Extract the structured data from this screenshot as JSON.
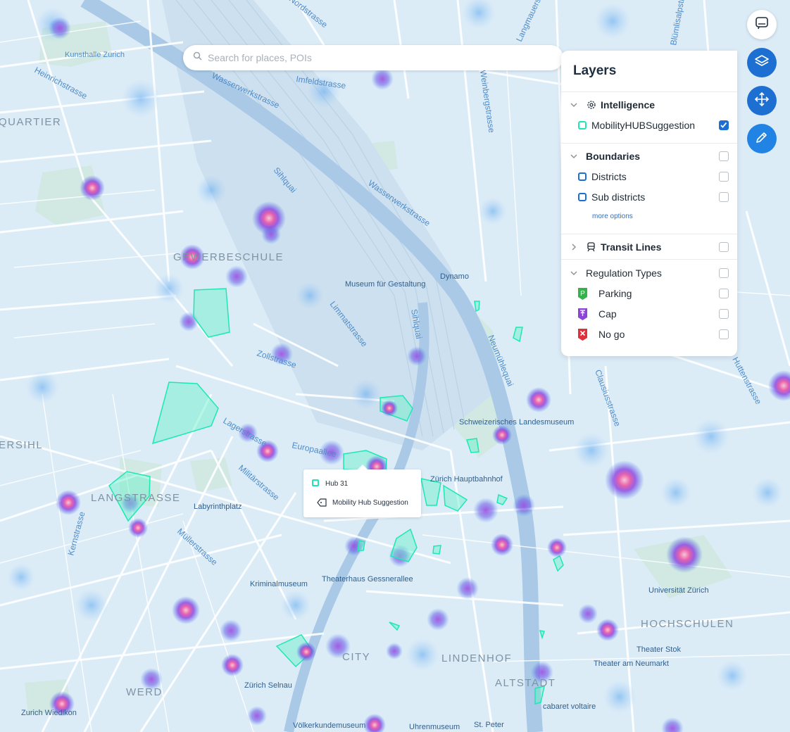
{
  "search": {
    "placeholder": "Search for places, POIs"
  },
  "buttons": {
    "chat": "chat-icon",
    "layers": "layers-icon",
    "move": "move-icon",
    "edit": "pencil-icon"
  },
  "colors": {
    "accent": "#1d6fd1",
    "hub": "#1de8b5",
    "heat_core": "#f8c9d8",
    "heat_glow": "#8b3fd9"
  },
  "layers_panel": {
    "title": "Layers",
    "sections": [
      {
        "label": "Intelligence",
        "icon": "gear-icon",
        "expanded": true,
        "checked": null,
        "items": [
          {
            "label": "MobilityHUBSuggestion",
            "swatch": "#1de8b5",
            "checked": true
          }
        ]
      },
      {
        "label": "Boundaries",
        "expanded": true,
        "checked": false,
        "items": [
          {
            "label": "Districts",
            "swatch": "#1d6fd1",
            "checked": false
          },
          {
            "label": "Sub districts",
            "swatch": "#1d6fd1",
            "checked": false
          }
        ],
        "more": "more options"
      },
      {
        "label": "Transit Lines",
        "icon": "train-icon",
        "expanded": false,
        "checked": false,
        "items": []
      },
      {
        "label": "Regulation Types",
        "expanded": true,
        "checked": false,
        "items": [
          {
            "label": "Parking",
            "badge": "P",
            "color": "#36b24a",
            "checked": false
          },
          {
            "label": "Cap",
            "badge": "↑",
            "color": "#8e44d9",
            "checked": false
          },
          {
            "label": "No go",
            "badge": "✕",
            "color": "#e0303a",
            "checked": false
          }
        ]
      }
    ]
  },
  "popup": {
    "title": "Hub 31",
    "type": "Mobility Hub Suggestion"
  },
  "map": {
    "districts": [
      "QUARTIER",
      "GEWERBESCHULE",
      "ERSIHL",
      "LANGSTRASSE",
      "CITY",
      "LINDENHOF",
      "ALTSTADT",
      "HOCHSCHULEN",
      "WERD"
    ],
    "streets": [
      "Heinrichstrasse",
      "Limmatstrasse",
      "Sihlquai",
      "Wasserwerkstrasse",
      "Zollstrasse",
      "Lagerstrasse",
      "Militärstrasse",
      "Europaallee",
      "Neumühlequai",
      "Müllerstrasse",
      "Kernstrasse",
      "Clausiusstrasse",
      "Huttenstrasse",
      "Nordstrasse",
      "Imfeldstrasse",
      "Langmauerstrasse",
      "Blümlisalpstrasse",
      "Weinbergstrasse",
      "Sihlquai",
      "Wasserwerkstrasse"
    ],
    "pois": [
      "Kunsthalle Zürich",
      "Museum für Gestaltung",
      "Dynamo",
      "Schweizerisches Landesmuseum",
      "Zürich Hauptbahnhof",
      "Labyrinthplatz",
      "Kriminalmuseum",
      "Theaterhaus Gessnerallee",
      "Zürich Selnau",
      "Zurich Wiedikon",
      "Völkerkundemuseum",
      "Uhrenmuseum",
      "St. Peter",
      "cabaret voltaire",
      "Theater am Neumarkt",
      "Theater Stok",
      "Universität Zürich"
    ]
  }
}
